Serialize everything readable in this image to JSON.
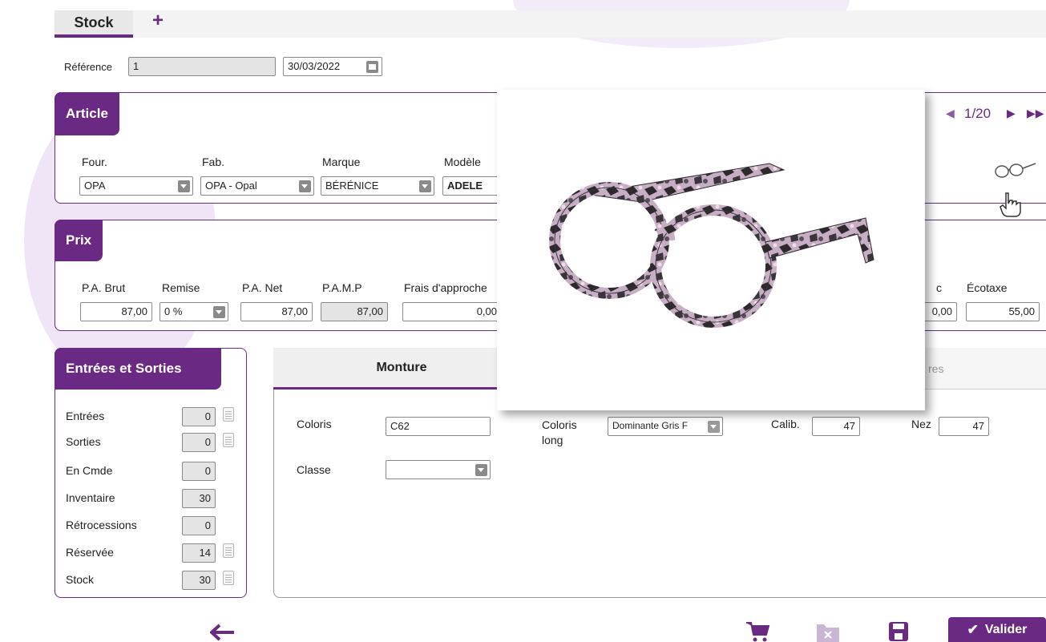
{
  "tabs": {
    "stock": "Stock",
    "add": "+"
  },
  "header": {
    "reference_label": "Référence",
    "reference_value": "1",
    "date_value": "30/03/2022"
  },
  "article": {
    "title": "Article",
    "pagination": "1/20",
    "fields": {
      "four_label": "Four.",
      "four_value": "OPA",
      "fab_label": "Fab.",
      "fab_value": "OPA - Opal",
      "marque_label": "Marque",
      "marque_value": "BÉRÉNICE",
      "modele_label": "Modèle",
      "modele_value": "ADELE"
    }
  },
  "prix": {
    "title": "Prix",
    "pa_brut_label": "P.A. Brut",
    "pa_brut_value": "87,00",
    "remise_label": "Remise",
    "remise_value": "0 %",
    "pa_net_label": "P.A. Net",
    "pa_net_value": "87,00",
    "pamp_label": "P.A.M.P",
    "pamp_value": "87,00",
    "frais_label": "Frais d'approche",
    "frais_value": "0,00",
    "c_label": "c",
    "c_value": "0,00",
    "ecotaxe_label": "Écotaxe",
    "ecotaxe_value": "55,00"
  },
  "entrees": {
    "title": "Entrées et Sorties",
    "rows": [
      {
        "label": "Entrées",
        "value": "0"
      },
      {
        "label": "Sorties",
        "value": "0"
      },
      {
        "label": "En Cmde",
        "value": "0"
      },
      {
        "label": "Inventaire",
        "value": "30"
      },
      {
        "label": "Rétrocessions",
        "value": "0"
      },
      {
        "label": "Réservée",
        "value": "14"
      },
      {
        "label": "Stock",
        "value": "30"
      }
    ]
  },
  "monture": {
    "tab_label": "Monture",
    "other_tab_partial": "res",
    "coloris_label": "Coloris",
    "coloris_value": "C62",
    "coloris_long_label": "Coloris long",
    "coloris_long_value": "Dominante Gris F",
    "calib_label": "Calib.",
    "calib_value": "47",
    "nez_label": "Nez",
    "nez_value": "47",
    "classe_label": "Classe",
    "classe_value": ""
  },
  "footer": {
    "valider_label": "Valider"
  },
  "colors": {
    "accent": "#6a2a84",
    "bg_deco": "#efe5f6"
  },
  "icons": [
    "back-arrow-icon",
    "cart-icon",
    "folder-cancel-icon",
    "save-icon",
    "check-icon",
    "calendar-icon",
    "glasses-icon",
    "hand-cursor-icon"
  ]
}
